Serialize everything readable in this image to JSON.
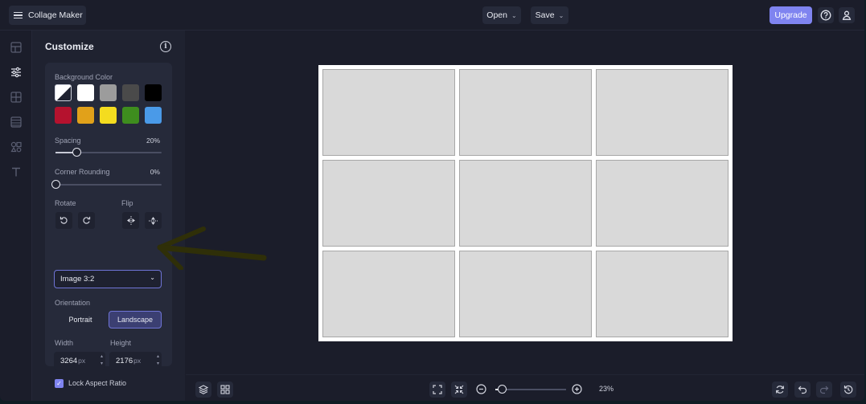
{
  "topbar": {
    "menu_icon": "hamburger-icon",
    "app_title": "Collage Maker",
    "open_label": "Open",
    "save_label": "Save",
    "upgrade_label": "Upgrade",
    "help_icon": "help-icon",
    "account_icon": "user-icon"
  },
  "rail": {
    "items": [
      {
        "icon": "layout-icon"
      },
      {
        "icon": "sliders-icon",
        "active": true
      },
      {
        "icon": "grid-icon"
      },
      {
        "icon": "background-icon"
      },
      {
        "icon": "elements-icon"
      },
      {
        "icon": "text-icon"
      }
    ]
  },
  "panel": {
    "title": "Customize",
    "info_icon": "info-icon",
    "background_color_label": "Background Color",
    "swatches": [
      "custom",
      "#ffffff",
      "#9c9c9c",
      "#4a4a4a",
      "#000000",
      "#b5122e",
      "#e1a11a",
      "#f4dc1f",
      "#3e8d1e",
      "#4a9ae8"
    ],
    "spacing_label": "Spacing",
    "spacing_value": "20%",
    "spacing_fraction": 0.2,
    "corner_label": "Corner Rounding",
    "corner_value": "0%",
    "corner_fraction": 0.0,
    "rotate_label": "Rotate",
    "flip_label": "Flip",
    "size_select": "Image 3:2",
    "orientation_label": "Orientation",
    "portrait_label": "Portrait",
    "landscape_label": "Landscape",
    "orientation_selected": "Landscape",
    "width_label": "Width",
    "height_label": "Height",
    "width_value": "3264",
    "height_value": "2176",
    "unit": "px",
    "lock_label": "Lock Aspect Ratio",
    "lock_checked": true
  },
  "canvas": {
    "rows": 3,
    "cols": 3,
    "cell_color": "#d9d9d9",
    "background": "#ffffff"
  },
  "bottombar": {
    "layers_icon": "layers-icon",
    "grid_icon": "grid-view-icon",
    "fit_icon": "fit-screen-icon",
    "shrink_icon": "shrink-icon",
    "zoom_out_icon": "zoom-out-icon",
    "zoom_in_icon": "zoom-in-icon",
    "zoom_value": "23%",
    "zoom_fraction": 0.1,
    "refresh_icon": "refresh-icon",
    "undo_icon": "undo-icon",
    "redo_icon": "redo-icon",
    "history_icon": "history-icon"
  },
  "colors": {
    "accent": "#7f84f0",
    "annotation_arrow": "#2f2f08"
  }
}
